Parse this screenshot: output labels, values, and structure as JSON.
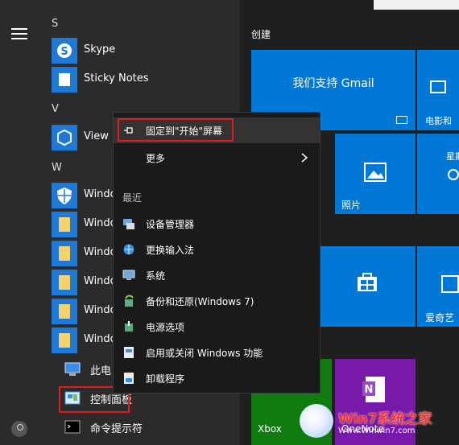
{
  "rail": {
    "menu_icon": "hamburger-icon",
    "user_icon": "user-icon"
  },
  "apps": {
    "section_s": "S",
    "skype": "Skype",
    "sticky": "Sticky Notes",
    "section_v": "V",
    "view3d": "View 3",
    "section_w": "W",
    "win1": "Windo",
    "win2": "Windo",
    "win3": "Windo",
    "win4": "Windo",
    "win5": "Windo",
    "win6": "Windo",
    "thispc": "此电",
    "control": "控制面板",
    "cmd": "命令提示符"
  },
  "tiles": {
    "group": "创建",
    "gmail": "我们支持 Gmail",
    "movies": "电影和",
    "weather": "星期",
    "photos": "照片",
    "iqiyi": "爱奇艺",
    "xbox": "Xbox",
    "onenote": "OneNote",
    "watermark": "Win7系统之家",
    "watermark_url": "Www.Winwin7.com"
  },
  "context_menu": {
    "pin": "固定到\"开始\"屏幕",
    "more": "更多",
    "recent": "最近",
    "items": [
      "设备管理器",
      "更换输入法",
      "系统",
      "备份和还原(Windows 7)",
      "电源选项",
      "启用或关闭 Windows 功能",
      "卸载程序"
    ]
  },
  "colors": {
    "accent": "#0078d7",
    "highlight": "#e21c1c",
    "xbox": "#107c10",
    "onenote": "#7719aa"
  }
}
